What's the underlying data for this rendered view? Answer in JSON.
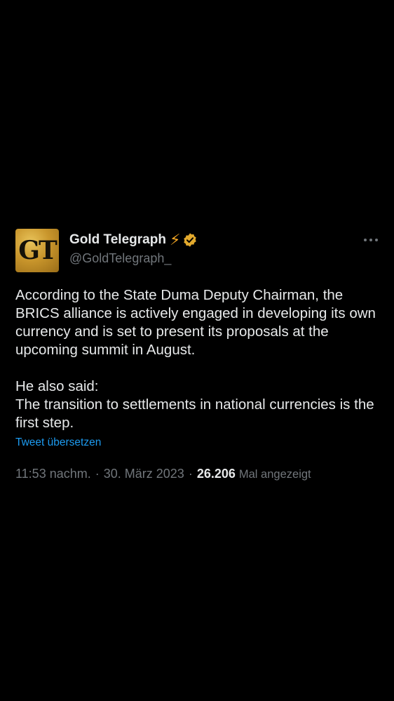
{
  "tweet": {
    "author": {
      "display_name": "Gold Telegraph",
      "handle": "@GoldTelegraph_",
      "avatar_text": "GT",
      "badge_icon": "lightning-bolt-icon",
      "verified_icon": "verified-badge-icon",
      "verified_color": "#e2a92d"
    },
    "more_icon": "more-options-icon",
    "paragraphs": [
      "According to the State Duma Deputy Chairman, the BRICS alliance is actively engaged in developing its own currency and is set to present its proposals at the upcoming summit in August.",
      "He also said:\nThe transition to settlements in national currencies is the first step."
    ],
    "translate_label": "Tweet übersetzen",
    "time": "11:53 nachm.",
    "date": "30. März 2023",
    "separator": "·",
    "views_count": "26.206",
    "views_label": "Mal angezeigt"
  },
  "colors": {
    "background": "#000000",
    "text_primary": "#e7e9ea",
    "text_secondary": "#71767b",
    "link": "#1d9bf0",
    "bolt": "#f5a623"
  }
}
